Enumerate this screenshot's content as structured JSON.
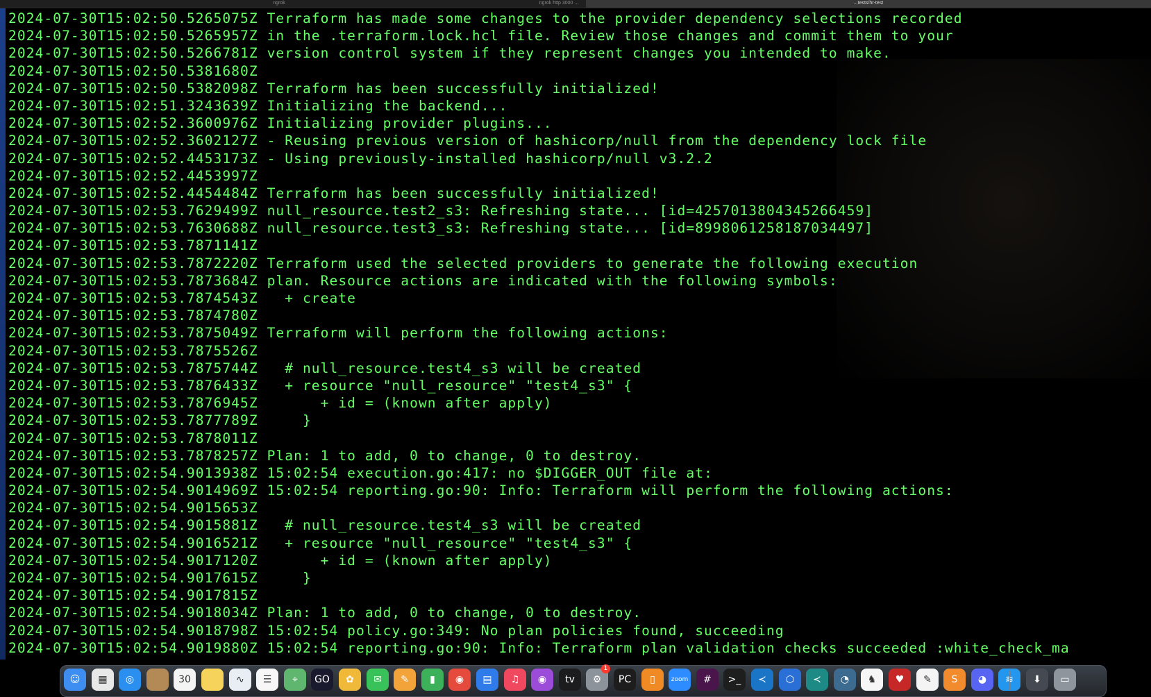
{
  "tabs": [
    "ngrok",
    "ngrok http 3000 ...",
    "...tests/hr-test"
  ],
  "terminal": {
    "lines": [
      {
        "ts": "2024-07-30T15:02:50.5265075Z",
        "text": "Terraform has made some changes to the provider dependency selections recorded"
      },
      {
        "ts": "2024-07-30T15:02:50.5265957Z",
        "text": "in the .terraform.lock.hcl file. Review those changes and commit them to your"
      },
      {
        "ts": "2024-07-30T15:02:50.5266781Z",
        "text": "version control system if they represent changes you intended to make."
      },
      {
        "ts": "2024-07-30T15:02:50.5381680Z",
        "text": ""
      },
      {
        "ts": "2024-07-30T15:02:50.5382098Z",
        "text": "Terraform has been successfully initialized!"
      },
      {
        "ts": "2024-07-30T15:02:51.3243639Z",
        "text": "Initializing the backend..."
      },
      {
        "ts": "2024-07-30T15:02:52.3600976Z",
        "text": "Initializing provider plugins..."
      },
      {
        "ts": "2024-07-30T15:02:52.3602127Z",
        "text": "- Reusing previous version of hashicorp/null from the dependency lock file"
      },
      {
        "ts": "2024-07-30T15:02:52.4453173Z",
        "text": "- Using previously-installed hashicorp/null v3.2.2"
      },
      {
        "ts": "2024-07-30T15:02:52.4453997Z",
        "text": ""
      },
      {
        "ts": "2024-07-30T15:02:52.4454484Z",
        "text": "Terraform has been successfully initialized!"
      },
      {
        "ts": "2024-07-30T15:02:53.7629499Z",
        "text": "null_resource.test2_s3: Refreshing state... [id=4257013804345266459]"
      },
      {
        "ts": "2024-07-30T15:02:53.7630688Z",
        "text": "null_resource.test3_s3: Refreshing state... [id=8998061258187034497]"
      },
      {
        "ts": "2024-07-30T15:02:53.7871141Z",
        "text": ""
      },
      {
        "ts": "2024-07-30T15:02:53.7872220Z",
        "text": "Terraform used the selected providers to generate the following execution"
      },
      {
        "ts": "2024-07-30T15:02:53.7873684Z",
        "text": "plan. Resource actions are indicated with the following symbols:"
      },
      {
        "ts": "2024-07-30T15:02:53.7874543Z",
        "text": "  + create"
      },
      {
        "ts": "2024-07-30T15:02:53.7874780Z",
        "text": ""
      },
      {
        "ts": "2024-07-30T15:02:53.7875049Z",
        "text": "Terraform will perform the following actions:"
      },
      {
        "ts": "2024-07-30T15:02:53.7875526Z",
        "text": ""
      },
      {
        "ts": "2024-07-30T15:02:53.7875744Z",
        "text": "  # null_resource.test4_s3 will be created"
      },
      {
        "ts": "2024-07-30T15:02:53.7876433Z",
        "text": "  + resource \"null_resource\" \"test4_s3\" {"
      },
      {
        "ts": "2024-07-30T15:02:53.7876945Z",
        "text": "      + id = (known after apply)"
      },
      {
        "ts": "2024-07-30T15:02:53.7877789Z",
        "text": "    }"
      },
      {
        "ts": "2024-07-30T15:02:53.7878011Z",
        "text": ""
      },
      {
        "ts": "2024-07-30T15:02:53.7878257Z",
        "text": "Plan: 1 to add, 0 to change, 0 to destroy."
      },
      {
        "ts": "2024-07-30T15:02:54.9013938Z",
        "text": "15:02:54 execution.go:417: no $DIGGER_OUT file at:"
      },
      {
        "ts": "2024-07-30T15:02:54.9014969Z",
        "text": "15:02:54 reporting.go:90: Info: Terraform will perform the following actions:"
      },
      {
        "ts": "2024-07-30T15:02:54.9015653Z",
        "text": ""
      },
      {
        "ts": "2024-07-30T15:02:54.9015881Z",
        "text": "  # null_resource.test4_s3 will be created"
      },
      {
        "ts": "2024-07-30T15:02:54.9016521Z",
        "text": "  + resource \"null_resource\" \"test4_s3\" {"
      },
      {
        "ts": "2024-07-30T15:02:54.9017120Z",
        "text": "      + id = (known after apply)"
      },
      {
        "ts": "2024-07-30T15:02:54.9017615Z",
        "text": "    }"
      },
      {
        "ts": "2024-07-30T15:02:54.9017815Z",
        "text": ""
      },
      {
        "ts": "2024-07-30T15:02:54.9018034Z",
        "text": "Plan: 1 to add, 0 to change, 0 to destroy."
      },
      {
        "ts": "2024-07-30T15:02:54.9018798Z",
        "text": "15:02:54 policy.go:349: No plan policies found, succeeding"
      },
      {
        "ts": "2024-07-30T15:02:54.9019880Z",
        "text": "15:02:54 reporting.go:90: Info: Terraform plan validation checks succeeded :white_check_ma"
      }
    ]
  },
  "dock": {
    "calendar_day": "30",
    "badge": "1",
    "items": [
      {
        "name": "finder-icon",
        "color": "#3d8ef0",
        "glyph": "☺"
      },
      {
        "name": "launchpad-icon",
        "color": "#e8e8e8",
        "glyph": "▦"
      },
      {
        "name": "safari-icon",
        "color": "#2b8ff0",
        "glyph": "◎"
      },
      {
        "name": "folder-icon",
        "color": "#b38a55",
        "glyph": ""
      },
      {
        "name": "calendar-icon",
        "color": "#f4f4f4",
        "glyph": "30"
      },
      {
        "name": "notes-icon",
        "color": "#f6d35b",
        "glyph": ""
      },
      {
        "name": "freeform-icon",
        "color": "#e9eef5",
        "glyph": "∿"
      },
      {
        "name": "reminders-icon",
        "color": "#f7f7f7",
        "glyph": "☰"
      },
      {
        "name": "maps-icon",
        "color": "#5fb66f",
        "glyph": "⌖"
      },
      {
        "name": "goland-icon",
        "color": "#1a1a2e",
        "glyph": "GO"
      },
      {
        "name": "photos-icon",
        "color": "#f0b93a",
        "glyph": "✿"
      },
      {
        "name": "messages-icon",
        "color": "#3ac25a",
        "glyph": "✉"
      },
      {
        "name": "pages-icon",
        "color": "#f2a33a",
        "glyph": "✎"
      },
      {
        "name": "numbers-icon",
        "color": "#3cb15a",
        "glyph": "▮"
      },
      {
        "name": "chrome-icon",
        "color": "#e44b3c",
        "glyph": "◉"
      },
      {
        "name": "keynote-icon",
        "color": "#2f7bea",
        "glyph": "▤"
      },
      {
        "name": "music-icon",
        "color": "#f0485f",
        "glyph": "♫"
      },
      {
        "name": "podcasts-icon",
        "color": "#9b4cd9",
        "glyph": "◉"
      },
      {
        "name": "appletv-icon",
        "color": "#1c1c1e",
        "glyph": "tv"
      },
      {
        "name": "system-settings-icon",
        "color": "#8d939b",
        "glyph": "⚙"
      },
      {
        "name": "pycharm-icon",
        "color": "#1d1d1d",
        "glyph": "PC"
      },
      {
        "name": "books-icon",
        "color": "#f08a24",
        "glyph": "▯"
      },
      {
        "name": "zoom-icon",
        "color": "#2d8cff",
        "glyph": "zoom"
      },
      {
        "name": "slack-icon",
        "color": "#4a154b",
        "glyph": "#"
      },
      {
        "name": "terminal-icon",
        "color": "#1e1e1e",
        "glyph": ">_"
      },
      {
        "name": "vscode-icon",
        "color": "#1a75c6",
        "glyph": "≺"
      },
      {
        "name": "sourcetree-icon",
        "color": "#2a6fd6",
        "glyph": "⬡"
      },
      {
        "name": "vscode-insiders-icon",
        "color": "#1d8a86",
        "glyph": "≺"
      },
      {
        "name": "dbeaver-icon",
        "color": "#3d6b8f",
        "glyph": "◔"
      },
      {
        "name": "tableplus-icon",
        "color": "#f6f6f6",
        "glyph": "♞"
      },
      {
        "name": "shield-app-icon",
        "color": "#c62828",
        "glyph": "♥"
      },
      {
        "name": "textedit-icon",
        "color": "#f4f4f4",
        "glyph": "✎"
      },
      {
        "name": "sublime-icon",
        "color": "#f28a2e",
        "glyph": "S"
      },
      {
        "name": "discord-icon",
        "color": "#5865f2",
        "glyph": "◕"
      },
      {
        "name": "docker-icon",
        "color": "#2496ed",
        "glyph": "≋"
      },
      {
        "name": "downloads-icon",
        "color": "#454a52",
        "glyph": "⬇"
      },
      {
        "name": "trash-icon",
        "color": "#8f959c",
        "glyph": "▭"
      }
    ]
  }
}
